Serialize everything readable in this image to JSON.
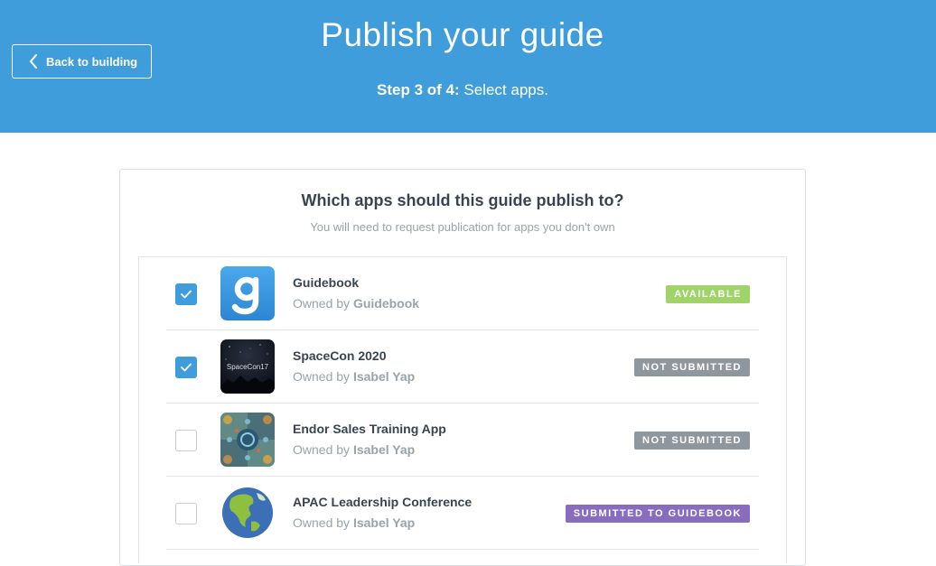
{
  "header": {
    "title": "Publish your guide",
    "back_label": "Back to building",
    "step_prefix": "Step 3 of 4:",
    "step_text": "Select apps."
  },
  "card": {
    "question": "Which apps should this guide publish to?",
    "subtitle": "You will need to request publication for apps you don't own"
  },
  "owned_by_label": "Owned by",
  "apps": [
    {
      "name": "Guidebook",
      "owner": "Guidebook",
      "checked": true,
      "status": "AVAILABLE",
      "status_color": "#a0d468",
      "icon": "guidebook-logo-icon"
    },
    {
      "name": "SpaceCon 2020",
      "owner": "Isabel Yap",
      "checked": true,
      "status": "NOT SUBMITTED",
      "status_color": "#8e979e",
      "icon": "spacecon-icon",
      "icon_text": "SpaceCon17"
    },
    {
      "name": "Endor Sales Training App",
      "owner": "Isabel Yap",
      "checked": false,
      "status": "NOT SUBMITTED",
      "status_color": "#8e979e",
      "icon": "endor-pattern-icon"
    },
    {
      "name": "APAC Leadership Conference",
      "owner": "Isabel Yap",
      "checked": false,
      "status": "SUBMITTED TO GUIDEBOOK",
      "status_color": "#8a6cbf",
      "icon": "globe-icon"
    }
  ],
  "colors": {
    "header_bg": "#3f9ddb",
    "checkbox_on": "#3f9ddb"
  }
}
